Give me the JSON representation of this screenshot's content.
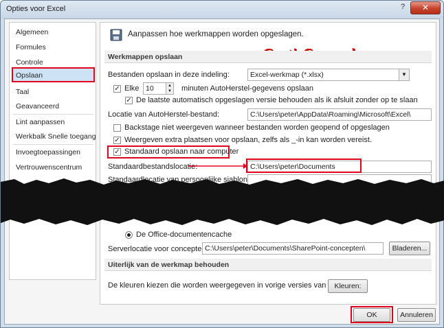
{
  "window": {
    "title": "Opties voor Excel",
    "help": "?",
    "close": "✕"
  },
  "nav": {
    "items": [
      "Algemeen",
      "Formules",
      "Controle",
      "Opslaan",
      "Taal",
      "Geavanceerd",
      "Lint aanpassen",
      "Werkbalk Snelle toegang",
      "Invoegtoepassingen",
      "Vertrouwenscentrum"
    ],
    "selected": "Opslaan"
  },
  "header": {
    "text": "Aanpassen hoe werkmappen worden opgeslagen."
  },
  "watermark": "www.GratisCursus.be",
  "save_section": {
    "title": "Werkmappen opslaan",
    "format_label": "Bestanden opslaan in deze indeling:",
    "format_value": "Excel-werkmap (*.xlsx)",
    "autosave_check": true,
    "autosave_prefix": "Elke",
    "autosave_minutes": "10",
    "autosave_suffix": "minuten AutoHerstel-gegevens opslaan",
    "keeplast_check": true,
    "keeplast_label": "De laatste automatisch opgeslagen versie behouden als ik afsluit zonder op te slaan",
    "autorecover_label": "Locatie van AutoHerstel-bestand:",
    "autorecover_value": "C:\\Users\\peter\\AppData\\Roaming\\Microsoft\\Excel\\",
    "backstage_check": false,
    "backstage_label": "Backstage niet weergeven wanneer bestanden worden geopend of opgeslagen",
    "extra_check": true,
    "extra_label": "Weergeven extra plaatsen voor opslaan, zelfs als _-in kan worden vereist.",
    "computer_check": true,
    "computer_label": "Standaard opslaan naar computer",
    "default_loc_label": "Standaardbestandslocatie:",
    "default_loc_value": "C:\\Users\\peter\\Documents",
    "personal_tpl_label": "Standaardlocatie van persoonlijke sjablonen:",
    "personal_tpl_value": ""
  },
  "server": {
    "radio_label": "De Office-documentencache",
    "server_label": "Serverlocatie voor concepten:",
    "server_value": "C:\\Users\\peter\\Documents\\SharePoint-concepten\\",
    "browse": "Bladeren..."
  },
  "appearance": {
    "title": "Uiterlijk van de werkmap behouden",
    "colors_label": "De kleuren kiezen die worden weergegeven in vorige versies van Excel:",
    "colors_button": "Kleuren:"
  },
  "footer": {
    "ok": "OK",
    "cancel": "Annuleren"
  },
  "colors": {
    "accent_red": "#e0001b",
    "selected_bg": "#cde3f5"
  }
}
